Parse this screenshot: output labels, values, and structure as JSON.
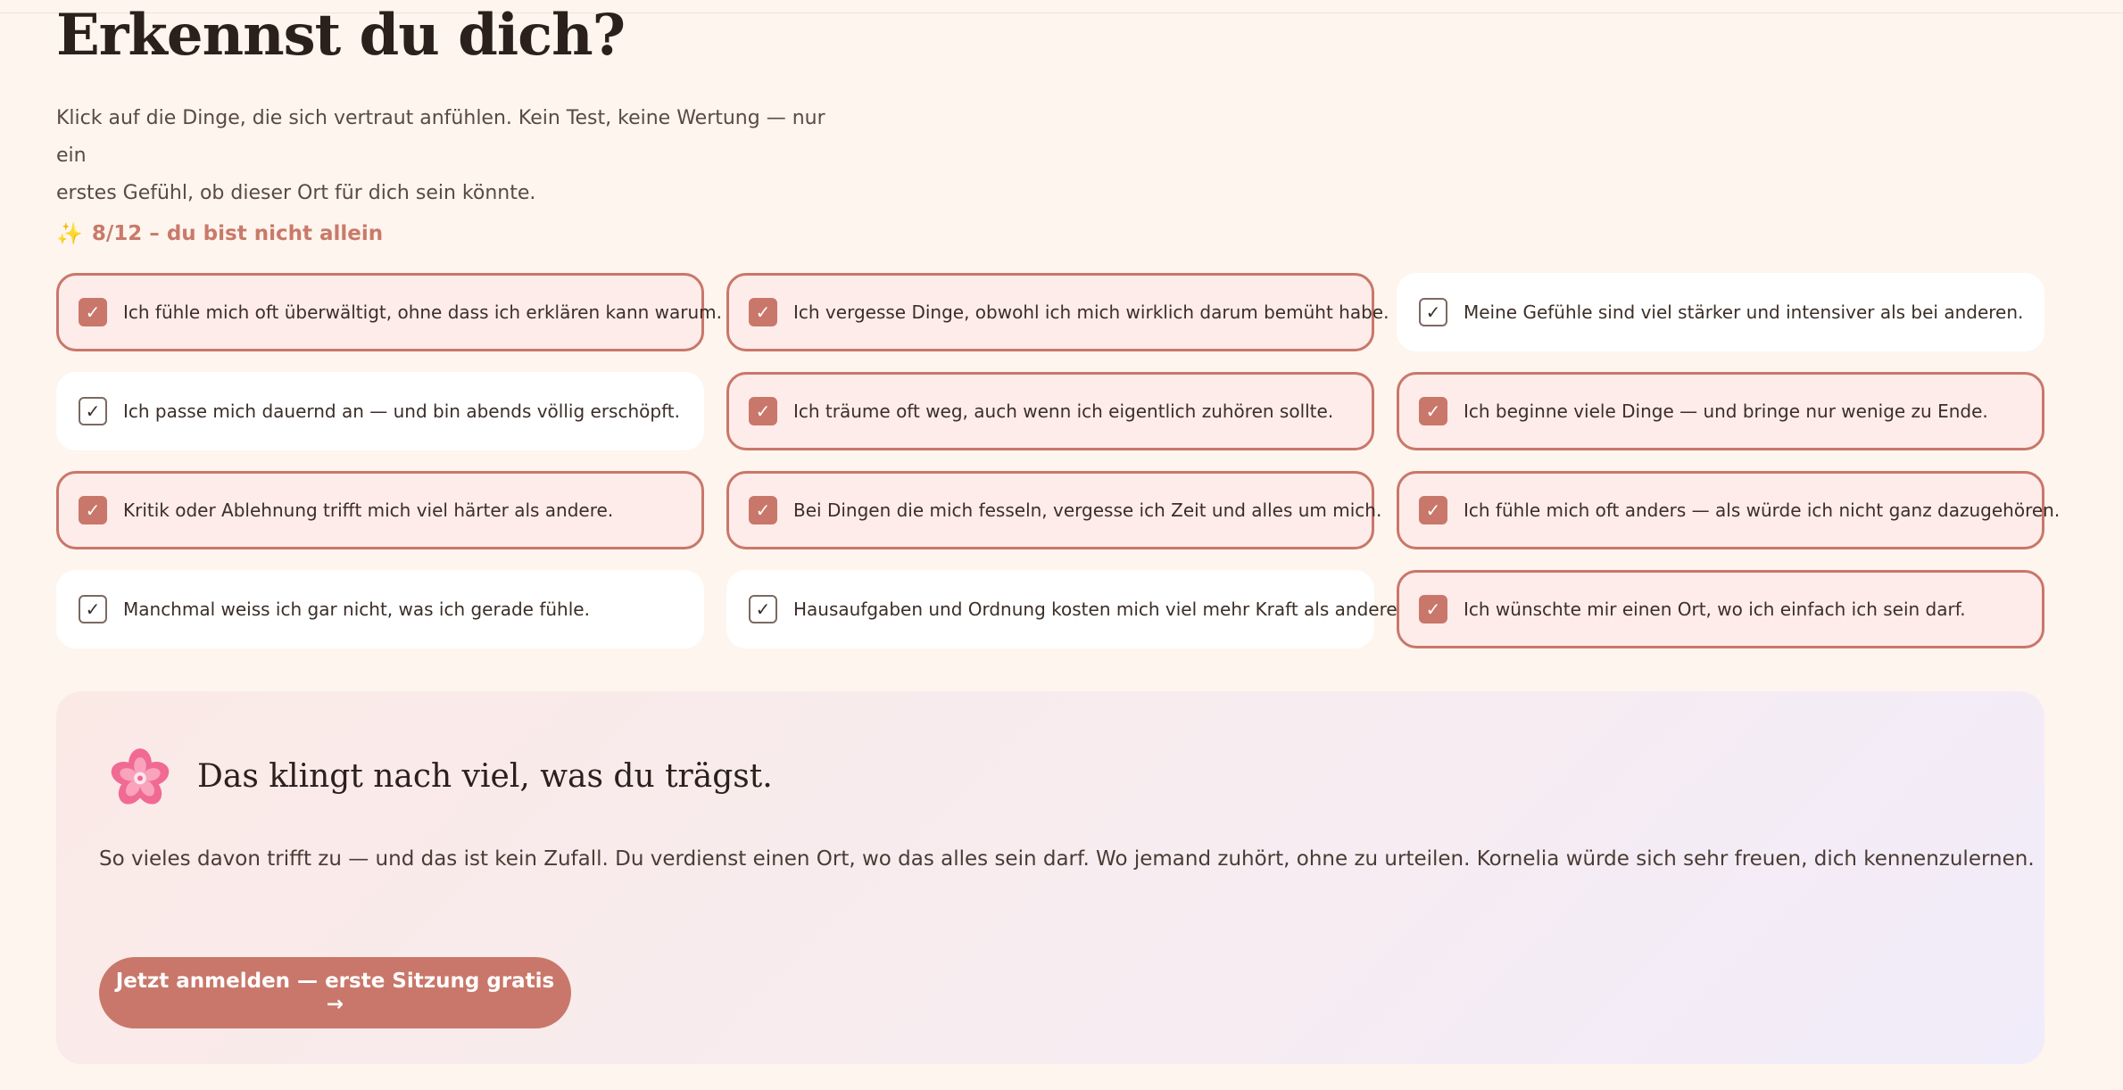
{
  "header": {
    "title": "Erkennst du dich?",
    "intro_line1": "Klick auf die Dinge, die sich vertraut anfühlen. Kein Test, keine Wertung — nur ein",
    "intro_line2": "erstes Gefühl, ob dieser Ort für dich sein könnte."
  },
  "counter": {
    "icon": "sparkles-icon",
    "text": "8/12 – du bist nicht allein"
  },
  "check_mark": "✓",
  "statements": [
    {
      "label": "Ich fühle mich oft überwältigt, ohne dass ich erklären kann warum.",
      "checked": true
    },
    {
      "label": "Ich vergesse Dinge, obwohl ich mich wirklich darum bemüht habe.",
      "checked": true
    },
    {
      "label": "Meine Gefühle sind viel stärker und intensiver als bei anderen.",
      "checked": false
    },
    {
      "label": "Ich passe mich dauernd an — und bin abends völlig erschöpft.",
      "checked": false
    },
    {
      "label": "Ich träume oft weg, auch wenn ich eigentlich zuhören sollte.",
      "checked": true
    },
    {
      "label": "Ich beginne viele Dinge — und bringe nur wenige zu Ende.",
      "checked": true
    },
    {
      "label": "Kritik oder Ablehnung trifft mich viel härter als andere.",
      "checked": true
    },
    {
      "label": "Bei Dingen die mich fesseln, vergesse ich Zeit und alles um mich.",
      "checked": true
    },
    {
      "label": "Ich fühle mich oft anders — als würde ich nicht ganz dazugehören.",
      "checked": true
    },
    {
      "label": "Manchmal weiss ich gar nicht, was ich gerade fühle.",
      "checked": false
    },
    {
      "label": "Hausaufgaben und Ordnung kosten mich viel mehr Kraft als andere.",
      "checked": false
    },
    {
      "label": "Ich wünschte mir einen Ort, wo ich einfach ich sein darf.",
      "checked": true
    }
  ],
  "result": {
    "icon": "cherry-blossom-icon",
    "title": "Das klingt nach viel, was du trägst.",
    "body": "So vieles davon trifft zu — und das ist kein Zufall. Du verdienst einen Ort, wo das alles sein darf. Wo jemand zuhört, ohne zu urteilen. Kornelia würde sich sehr freuen, dich kennenzulernen.",
    "cta_label": "Jetzt anmelden — erste Sitzung gratis →"
  },
  "colors": {
    "accent": "#c9776a",
    "background": "#fdf5ee",
    "card_checked_bg": "#fdecea"
  }
}
